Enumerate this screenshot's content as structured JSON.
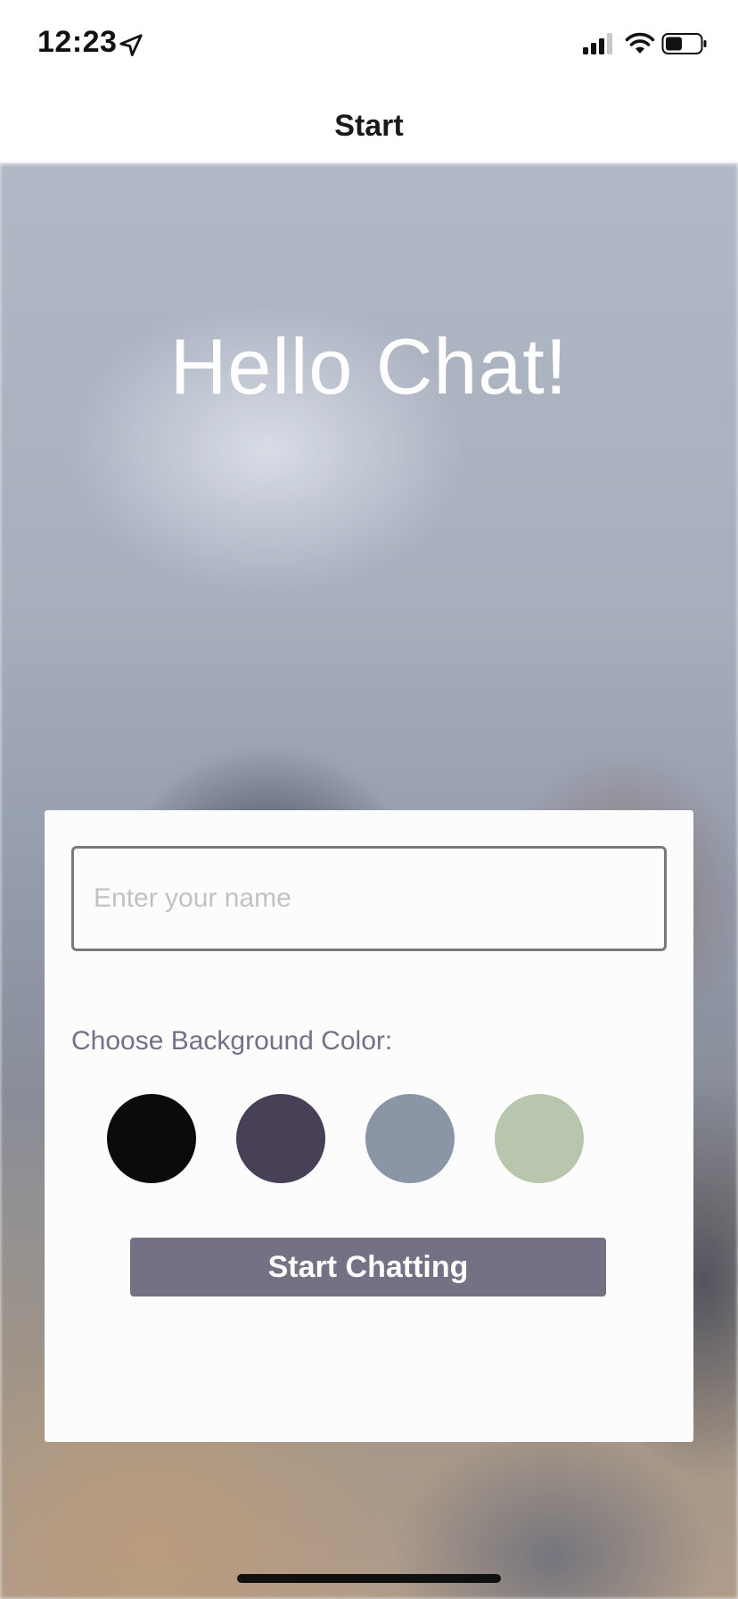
{
  "status_bar": {
    "time": "12:23",
    "icons": [
      "location-arrow-icon",
      "signal-icon",
      "wifi-icon",
      "battery-icon"
    ]
  },
  "nav": {
    "title": "Start"
  },
  "hero": {
    "title": "Hello Chat!"
  },
  "form": {
    "name_placeholder": "Enter your name",
    "name_value": "",
    "color_label": "Choose Background Color:",
    "colors": [
      "#090C08",
      "#474056",
      "#8A95A5",
      "#B9C6AE"
    ],
    "button_label": "Start Chatting",
    "button_color": "#757083"
  }
}
